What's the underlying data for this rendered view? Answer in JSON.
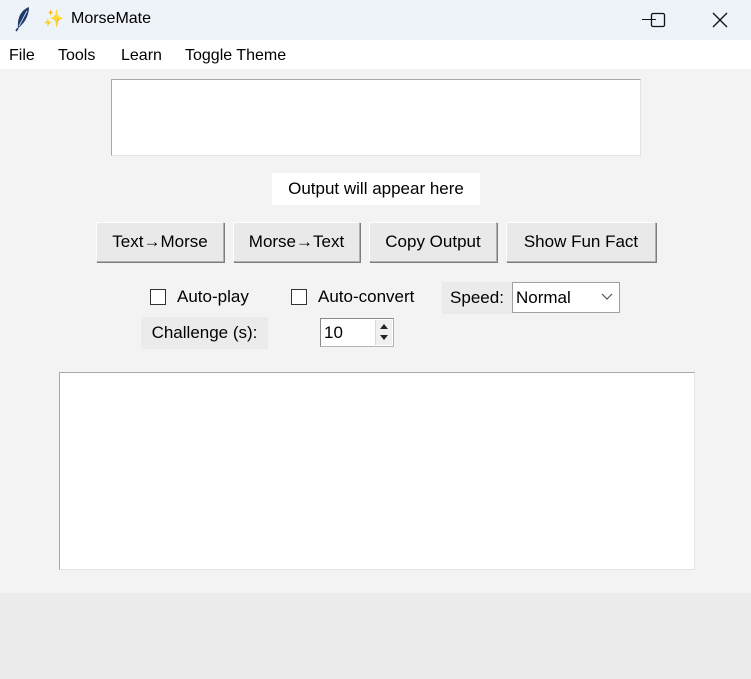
{
  "window": {
    "title": "MorseMate",
    "title_emoji": "✨",
    "app_icon": "feather-icon",
    "controls": [
      "minimize-icon",
      "maximize-icon",
      "close-icon"
    ]
  },
  "menu": {
    "items": [
      {
        "label": "File"
      },
      {
        "label": "Tools"
      },
      {
        "label": "Learn"
      },
      {
        "label": "Toggle Theme"
      }
    ]
  },
  "input": {
    "value": ""
  },
  "output": {
    "placeholder_text": "Output will appear here"
  },
  "buttons": {
    "text_to_morse": "Text→Morse",
    "morse_to_text": "Morse→Text",
    "copy_output": "Copy Output",
    "fun_fact": "Show Fun Fact"
  },
  "options": {
    "auto_play": {
      "label": "Auto-play",
      "checked": false
    },
    "auto_convert": {
      "label": "Auto-convert",
      "checked": false
    },
    "speed": {
      "label": "Speed:",
      "selected": "Normal"
    },
    "challenge": {
      "label": "Challenge (s):",
      "value": "10"
    }
  },
  "log": {
    "value": ""
  },
  "colors": {
    "titlebar": "#eef2f9",
    "background": "#f3f3f3",
    "button_face": "#e9e9e9"
  }
}
